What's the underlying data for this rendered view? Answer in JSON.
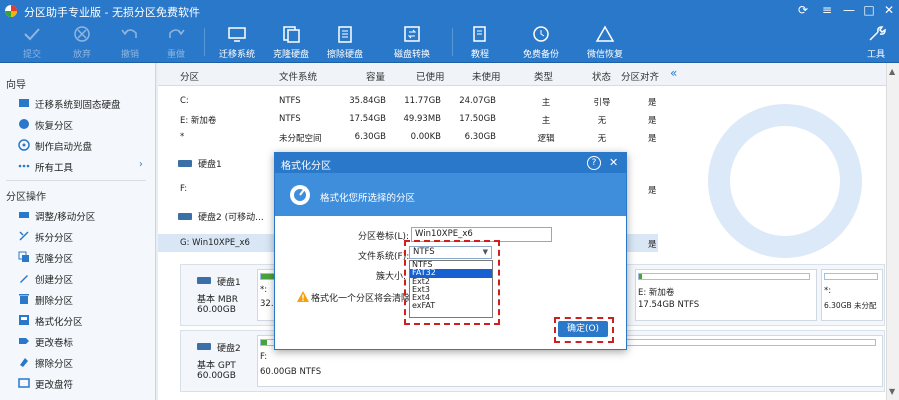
{
  "app": {
    "title": "分区助手专业版 - 无损分区免费软件"
  },
  "toolbar": {
    "items": [
      {
        "label": "提交",
        "icon": "check-icon",
        "disabled": true
      },
      {
        "label": "放弃",
        "icon": "cancel-icon",
        "disabled": true
      },
      {
        "label": "撤销",
        "icon": "undo-icon",
        "disabled": true
      },
      {
        "label": "重做",
        "icon": "redo-icon",
        "disabled": true
      },
      {
        "label": "迁移系统",
        "icon": "migrate-os-icon",
        "disabled": false
      },
      {
        "label": "克隆硬盘",
        "icon": "clone-disk-icon",
        "disabled": false
      },
      {
        "label": "擦除硬盘",
        "icon": "wipe-disk-icon",
        "disabled": false
      },
      {
        "label": "磁盘转换",
        "icon": "disk-convert-icon",
        "disabled": false
      },
      {
        "label": "教程",
        "icon": "tutorial-icon",
        "disabled": false
      },
      {
        "label": "免费备份",
        "icon": "backup-icon",
        "disabled": false
      },
      {
        "label": "微信恢复",
        "icon": "wechat-recover-icon",
        "disabled": false
      },
      {
        "label": "工具",
        "icon": "tools-icon",
        "disabled": false
      }
    ]
  },
  "sidebar": {
    "wizard_title": "向导",
    "wizard_items": [
      {
        "label": "迁移系统到固态硬盘",
        "icon": "migrate-ssd-icon"
      },
      {
        "label": "恢复分区",
        "icon": "recover-partition-icon"
      },
      {
        "label": "制作启动光盘",
        "icon": "boot-disc-icon"
      },
      {
        "label": "所有工具",
        "icon": "all-tools-icon"
      }
    ],
    "partition_ops_title": "分区操作",
    "partition_ops": [
      {
        "label": "调整/移动分区",
        "icon": "resize-icon"
      },
      {
        "label": "拆分分区",
        "icon": "split-icon"
      },
      {
        "label": "克隆分区",
        "icon": "clone-partition-icon"
      },
      {
        "label": "创建分区",
        "icon": "create-partition-icon"
      },
      {
        "label": "删除分区",
        "icon": "delete-partition-icon"
      },
      {
        "label": "格式化分区",
        "icon": "format-icon"
      },
      {
        "label": "更改卷标",
        "icon": "label-icon"
      },
      {
        "label": "擦除分区",
        "icon": "wipe-partition-icon"
      },
      {
        "label": "更改盘符",
        "icon": "drive-letter-icon"
      }
    ]
  },
  "table": {
    "headers": [
      "分区",
      "文件系统",
      "容量",
      "已使用",
      "未使用",
      "类型",
      "状态",
      "分区对齐"
    ],
    "rows": [
      [
        "C:",
        "NTFS",
        "35.84GB",
        "11.77GB",
        "24.07GB",
        "主",
        "引导",
        "是"
      ],
      [
        "E: 新加卷",
        "NTFS",
        "17.54GB",
        "49.93MB",
        "17.50GB",
        "主",
        "无",
        "是"
      ],
      [
        "*",
        "未分配空间",
        "6.30GB",
        "0.00KB",
        "6.30GB",
        "逻辑",
        "无",
        "是"
      ]
    ],
    "disk1_label": "硬盘1",
    "disk1_rows": [
      [
        "F:",
        "是"
      ]
    ],
    "disk2_label": "硬盘2 (可移动...",
    "disk2_rows": [
      [
        "G: Win10XPE_x6",
        "是"
      ]
    ]
  },
  "disks": [
    {
      "name": "硬盘1",
      "type": "基本 MBR",
      "size": "60.00GB",
      "parts": [
        {
          "label": "*:",
          "info": "32...",
          "fill": 0.33
        },
        {
          "label": "E: 新加卷",
          "info": "17.54GB NTFS",
          "fill": 0.02
        },
        {
          "label": "*:",
          "info": "6.30GB 未分配",
          "fill": 0
        }
      ]
    },
    {
      "name": "硬盘2",
      "type": "基本 GPT",
      "size": "60.00GB",
      "parts": [
        {
          "label": "F:",
          "info": "60.00GB NTFS",
          "fill": 0.01
        }
      ]
    }
  ],
  "dialog": {
    "title": "格式化分区",
    "help": "?",
    "banner": "格式化您所选择的分区",
    "label_volume": "分区卷标(L):",
    "volume_value": "Win10XPE_x6",
    "label_fs": "文件系统(F):",
    "fs_selected": "NTFS",
    "label_cluster": "簇大小:",
    "warning": "格式化一个分区将会清除",
    "fs_options": [
      "NTFS",
      "FAT32",
      "Ext2",
      "Ext3",
      "Ext4",
      "exFAT"
    ],
    "fs_highlight": "FAT32",
    "ok_label": "确定(O)"
  },
  "colors": {
    "accent": "#2a78c9",
    "highlight": "#d0201e",
    "bar": "#4aa33a"
  }
}
